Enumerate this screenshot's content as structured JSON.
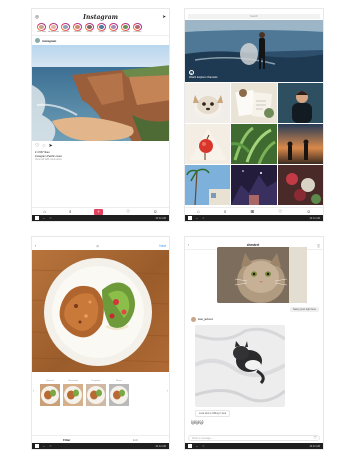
{
  "feed": {
    "title": "Instagram",
    "stories": [
      {
        "label": "Your Story",
        "color": "#c7a48a"
      },
      {
        "label": "luckynewbor",
        "color": "#e2b6a0"
      },
      {
        "label": "thornhall",
        "color": "#8da2b6"
      },
      {
        "label": "artiselim",
        "color": "#c98c6e"
      },
      {
        "label": "hoaphi",
        "color": "#7d6a5a"
      },
      {
        "label": "natgeo",
        "color": "#4d7aa3"
      },
      {
        "label": "thesam",
        "color": "#a58fb8"
      },
      {
        "label": "loremmm",
        "color": "#6d8f5a"
      },
      {
        "label": "jenniferp",
        "color": "#b36b6b"
      }
    ],
    "post_user": "instagram",
    "likes": "♥ 4,567 likes",
    "caption": "instagram Pacific coast",
    "comments": "View all 128 comments"
  },
  "explore": {
    "search_placeholder": "Search",
    "hero_label": "Watch Explore Channels"
  },
  "editor": {
    "back": "‹",
    "title": "",
    "next": "Next",
    "filters": [
      "Normal",
      "Clarendon",
      "Gingham",
      "Moon"
    ],
    "tab_filter": "Filter",
    "tab_edit": "Edit"
  },
  "direct": {
    "title": "chestert",
    "back": "‹",
    "reply1": "Sassy puss right here",
    "sender": "kate_jackson",
    "reply2": "Look who's chilling in bed",
    "reactions": "🐱🐱🐱",
    "input_placeholder": "Write a message..."
  },
  "taskbar": {
    "time": "10:12 AM"
  }
}
